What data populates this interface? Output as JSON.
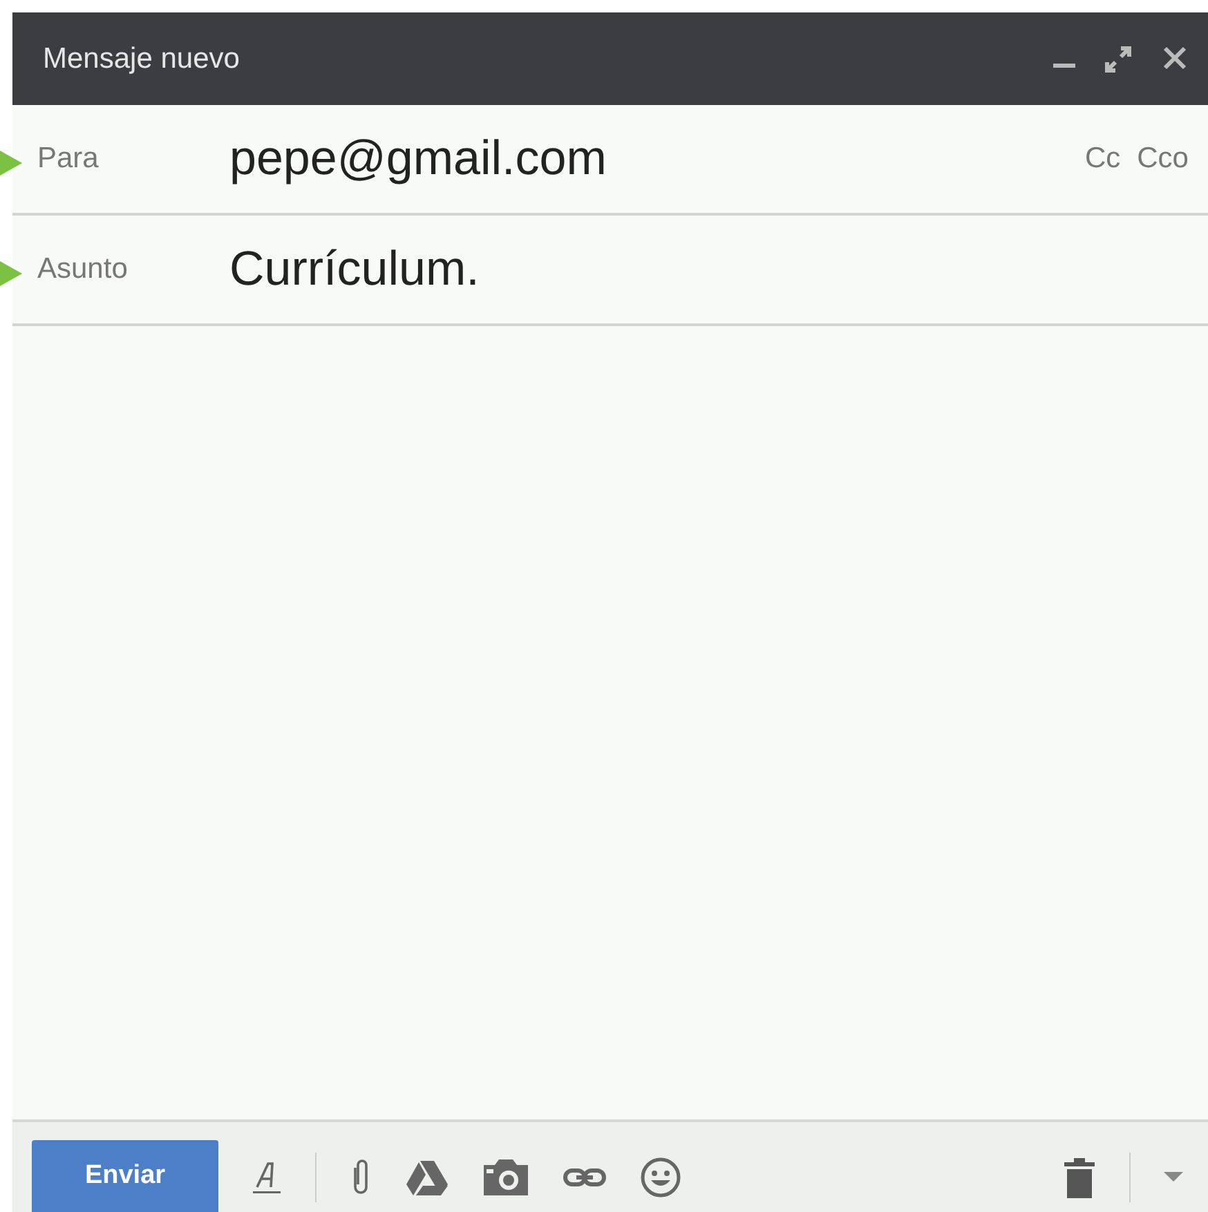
{
  "window": {
    "title": "Mensaje nuevo"
  },
  "fields": [
    {
      "label": "Para",
      "value": "pepe@gmail.com",
      "pointer": true
    },
    {
      "label": "Asunto",
      "value": "Currículum.",
      "pointer": true
    }
  ],
  "recipient_links": [
    "Cc",
    "Cco"
  ],
  "toolbar": {
    "send": "Enviar"
  }
}
